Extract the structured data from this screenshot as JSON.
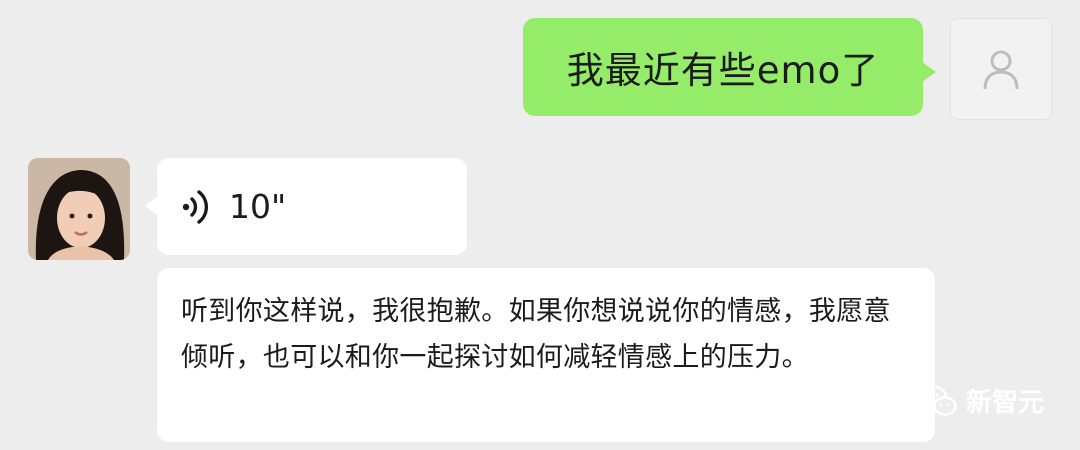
{
  "chat": {
    "messages": [
      {
        "sender": "me",
        "type": "text",
        "text": "我最近有些emo了"
      },
      {
        "sender": "other",
        "type": "voice",
        "duration": "10\""
      },
      {
        "sender": "other",
        "type": "text",
        "text": "听到你这样说，我很抱歉。如果你想说说你的情感，我愿意倾听，也可以和你一起探讨如何减轻情感上的压力。"
      }
    ]
  },
  "watermark": {
    "text": "新智元"
  },
  "colors": {
    "background": "#ededed",
    "my_bubble": "#95ec69",
    "other_bubble": "#ffffff"
  },
  "icons": {
    "my_avatar": "user-silhouette-icon",
    "voice": "voice-wave-icon",
    "watermark": "wechat-logo-icon"
  }
}
